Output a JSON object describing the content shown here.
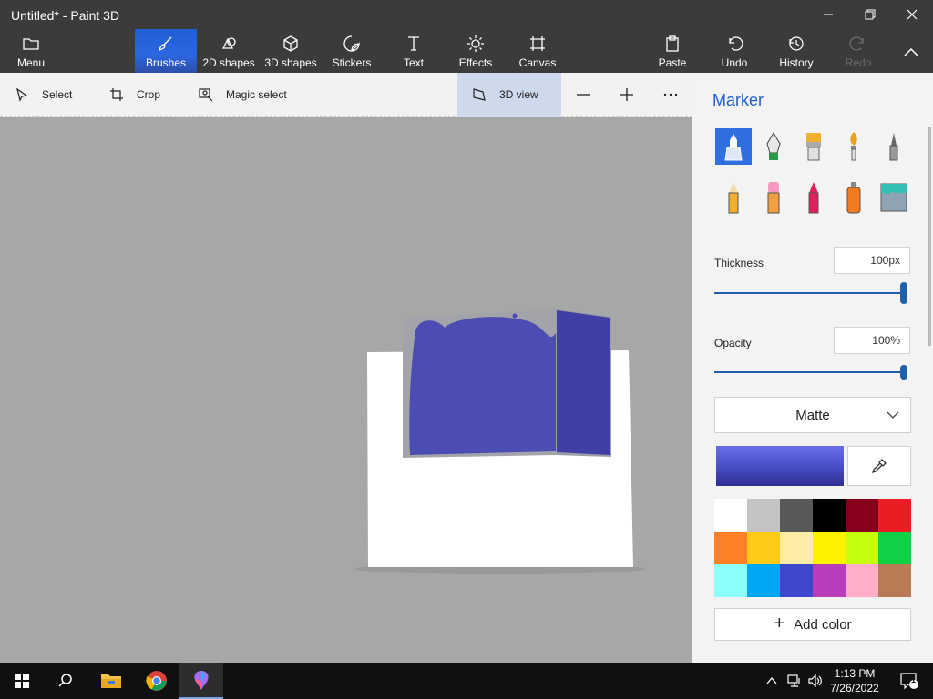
{
  "window": {
    "title": "Untitled* - Paint 3D"
  },
  "ribbon": {
    "menu": "Menu",
    "brushes": "Brushes",
    "shapes2d": "2D shapes",
    "shapes3d": "3D shapes",
    "stickers": "Stickers",
    "text": "Text",
    "effects": "Effects",
    "canvas": "Canvas",
    "paste": "Paste",
    "undo": "Undo",
    "history": "History",
    "redo": "Redo"
  },
  "toolbar": {
    "select": "Select",
    "crop": "Crop",
    "magic_select": "Magic select",
    "view3d": "3D view"
  },
  "panel": {
    "title": "Marker",
    "thickness_label": "Thickness",
    "thickness_value": "100px",
    "thickness_level": 1.0,
    "opacity_label": "Opacity",
    "opacity_value": "100%",
    "opacity_level": 1.0,
    "finish": "Matte",
    "add_color": "Add color",
    "current_color": "#4a4fc8",
    "palette": [
      "#ffffff",
      "#c3c3c3",
      "#585858",
      "#000000",
      "#88001b",
      "#ec1c24",
      "#ff7f27",
      "#ffca18",
      "#fdeca6",
      "#fff200",
      "#c4ff0e",
      "#0ed145",
      "#8cfffb",
      "#00a8f3",
      "#3f48cc",
      "#b83dba",
      "#ffaec8",
      "#b97a56"
    ]
  },
  "taskbar": {
    "time": "1:13 PM",
    "date": "7/26/2022",
    "notification_count": "1"
  }
}
